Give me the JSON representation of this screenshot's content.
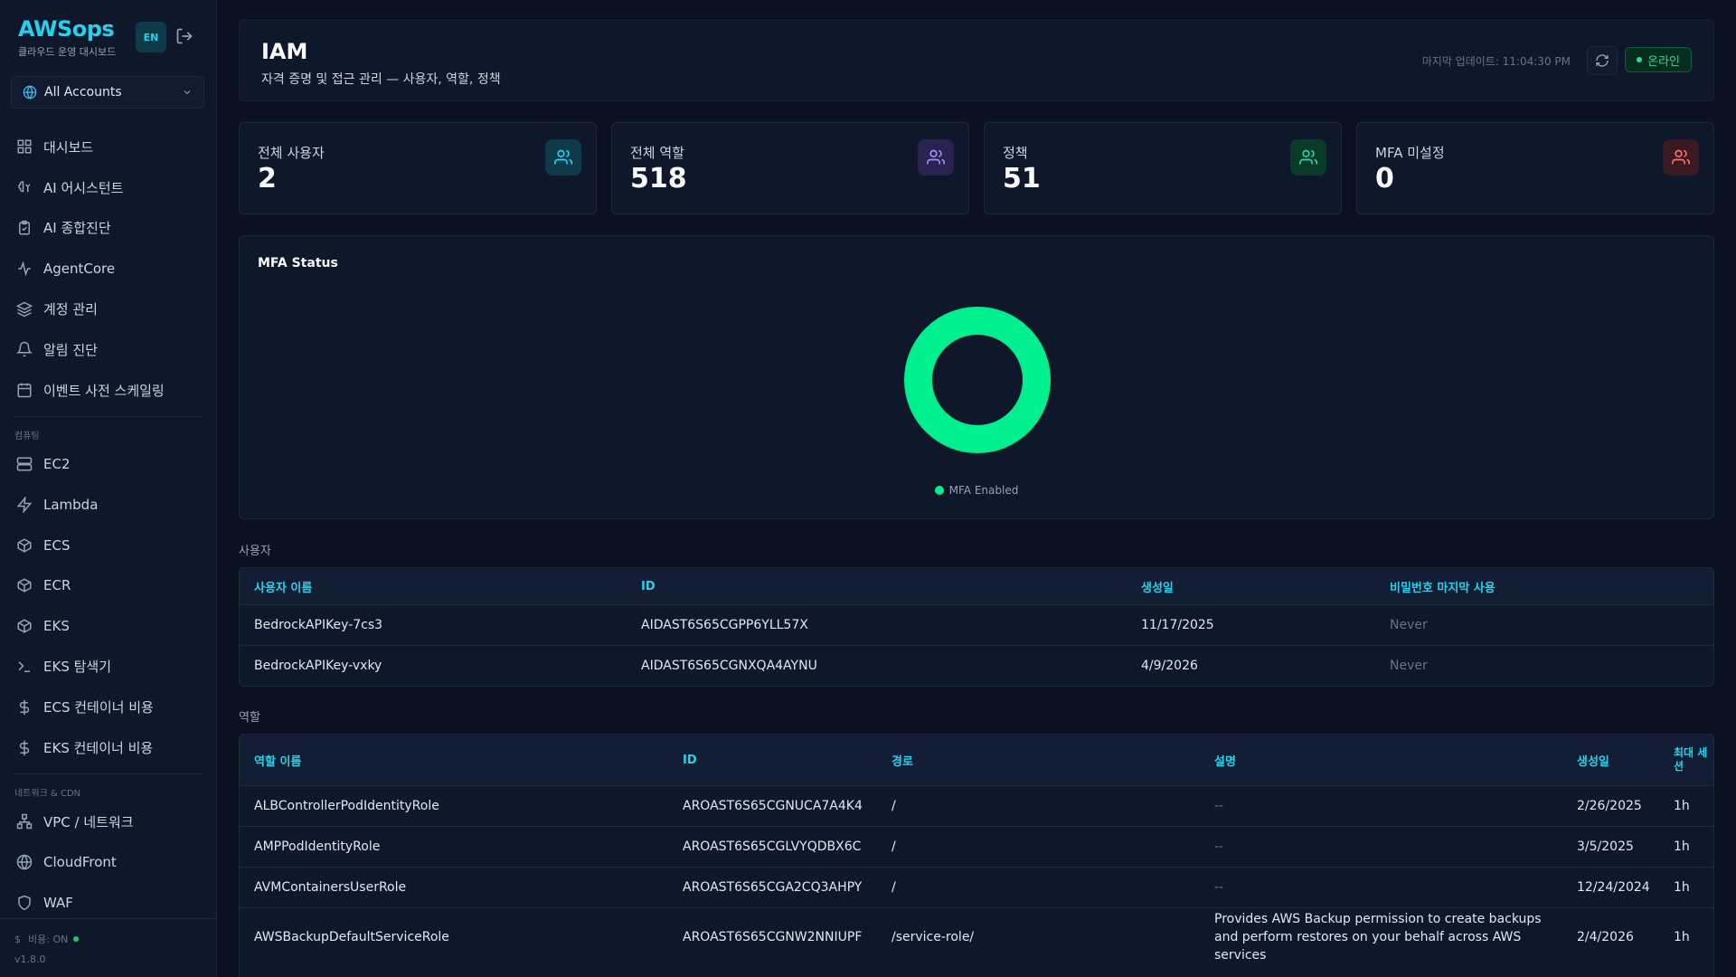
{
  "brand": {
    "title": "AWSops",
    "subtitle": "클라우드 운영 대시보드",
    "lang": "EN"
  },
  "account_selector": {
    "value": "All Accounts"
  },
  "nav": {
    "top": [
      {
        "label": "대시보드",
        "icon": "dashboard-icon"
      },
      {
        "label": "AI 어시스턴트",
        "icon": "brain-icon"
      },
      {
        "label": "AI 종합진단",
        "icon": "clipboard-icon"
      },
      {
        "label": "AgentCore",
        "icon": "activity-icon"
      },
      {
        "label": "계정 관리",
        "icon": "layers-icon"
      },
      {
        "label": "알림 진단",
        "icon": "bell-icon"
      },
      {
        "label": "이벤트 사전 스케일링",
        "icon": "calendar-icon"
      }
    ],
    "compute_section": "컴퓨팅",
    "compute": [
      {
        "label": "EC2",
        "icon": "server-icon"
      },
      {
        "label": "Lambda",
        "icon": "bolt-icon"
      },
      {
        "label": "ECS",
        "icon": "box-icon"
      },
      {
        "label": "ECR",
        "icon": "box-icon"
      },
      {
        "label": "EKS",
        "icon": "box-icon"
      },
      {
        "label": "EKS 탐색기",
        "icon": "terminal-icon"
      },
      {
        "label": "ECS 컨테이너 비용",
        "icon": "dollar-icon"
      },
      {
        "label": "EKS 컨테이너 비용",
        "icon": "dollar-icon"
      }
    ],
    "network_section": "네트워크 & CDN",
    "network": [
      {
        "label": "VPC / 네트워크",
        "icon": "network-icon"
      },
      {
        "label": "CloudFront",
        "icon": "globe-icon"
      },
      {
        "label": "WAF",
        "icon": "shield-icon"
      }
    ]
  },
  "footer": {
    "cost": "비용: ON",
    "version": "v1.8.0"
  },
  "header": {
    "title": "IAM",
    "subtitle": "자격 증명 및 접근 관리 — 사용자, 역할, 정책",
    "last_update": "마지막 업데이트: 11:04:30 PM",
    "status": "온라인"
  },
  "stats": [
    {
      "label": "전체 사용자",
      "value": "2",
      "color": "#22d3ee",
      "bg": "#0e3a4a"
    },
    {
      "label": "전체 역할",
      "value": "518",
      "color": "#a78bfa",
      "bg": "#2a2350"
    },
    {
      "label": "정책",
      "value": "51",
      "color": "#34d399",
      "bg": "#0a3a2a"
    },
    {
      "label": "MFA 미설정",
      "value": "0",
      "color": "#f87171",
      "bg": "#3a1a22"
    }
  ],
  "chart_data": {
    "type": "pie",
    "title": "MFA Status",
    "series": [
      {
        "name": "MFA Enabled",
        "value": 2,
        "color": "#00f090"
      }
    ]
  },
  "users": {
    "label": "사용자",
    "columns": [
      "사용자 이름",
      "ID",
      "생성일",
      "비밀번호 마지막 사용"
    ],
    "rows": [
      [
        "BedrockAPIKey-7cs3",
        "AIDAST6S65CGPP6YLL57X",
        "11/17/2025",
        "Never"
      ],
      [
        "BedrockAPIKey-vxky",
        "AIDAST6S65CGNXQA4AYNU",
        "4/9/2026",
        "Never"
      ]
    ]
  },
  "roles": {
    "label": "역할",
    "columns": [
      "역할 이름",
      "ID",
      "경로",
      "설명",
      "생성일",
      "최대 세션"
    ],
    "rows": [
      [
        "ALBControllerPodIdentityRole",
        "AROAST6S65CGNUCA7A4K4",
        "/",
        "--",
        "2/26/2025",
        "1h"
      ],
      [
        "AMPPodIdentityRole",
        "AROAST6S65CGLVYQDBX6C",
        "/",
        "--",
        "3/5/2025",
        "1h"
      ],
      [
        "AVMContainersUserRole",
        "AROAST6S65CGA2CQ3AHPY",
        "/",
        "--",
        "12/24/2024",
        "1h"
      ],
      [
        "AWSBackupDefaultServiceRole",
        "AROAST6S65CGNW2NNIUPF",
        "/service-role/",
        "Provides AWS Backup permission to create backups and perform restores on your behalf across AWS services",
        "2/4/2026",
        "1h"
      ]
    ]
  }
}
